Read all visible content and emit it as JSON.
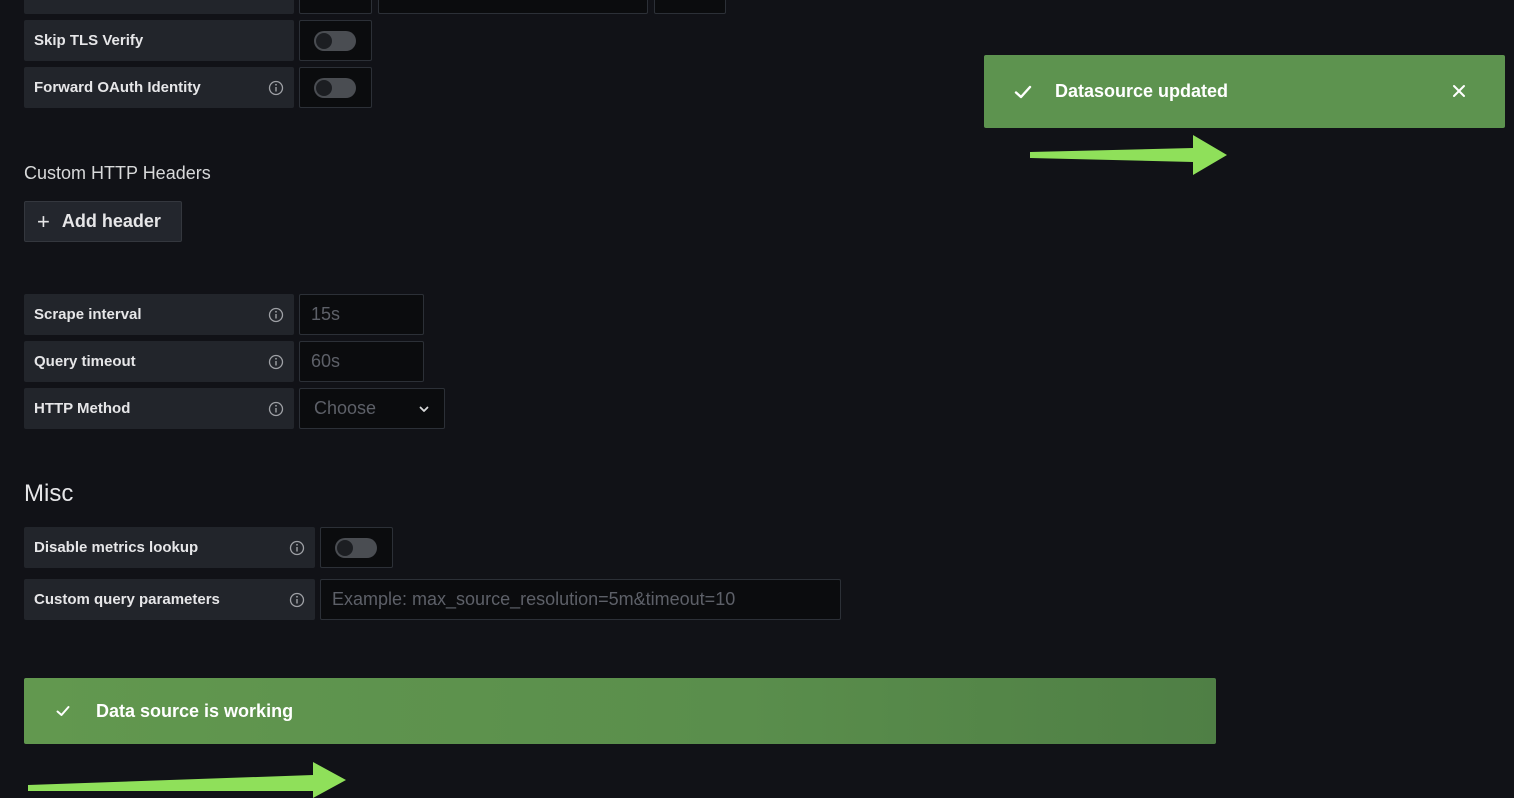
{
  "auth": {
    "skip_tls_label": "Skip TLS Verify",
    "forward_oauth_label": "Forward OAuth Identity"
  },
  "custom_headers": {
    "section_label": "Custom HTTP Headers",
    "add_header_label": "Add header"
  },
  "prometheus": {
    "scrape_interval_label": "Scrape interval",
    "scrape_interval_placeholder": "15s",
    "query_timeout_label": "Query timeout",
    "query_timeout_placeholder": "60s",
    "http_method_label": "HTTP Method",
    "http_method_value": "Choose"
  },
  "misc": {
    "title": "Misc",
    "disable_metrics_label": "Disable metrics lookup",
    "custom_query_label": "Custom query parameters",
    "custom_query_placeholder": "Example: max_source_resolution=5m&timeout=10"
  },
  "toast": {
    "message": "Datasource updated"
  },
  "status_alert": {
    "message": "Data source is working"
  },
  "colors": {
    "background": "#111217",
    "success_green": "#5d934f",
    "annotation_arrow": "#8fe05a"
  }
}
